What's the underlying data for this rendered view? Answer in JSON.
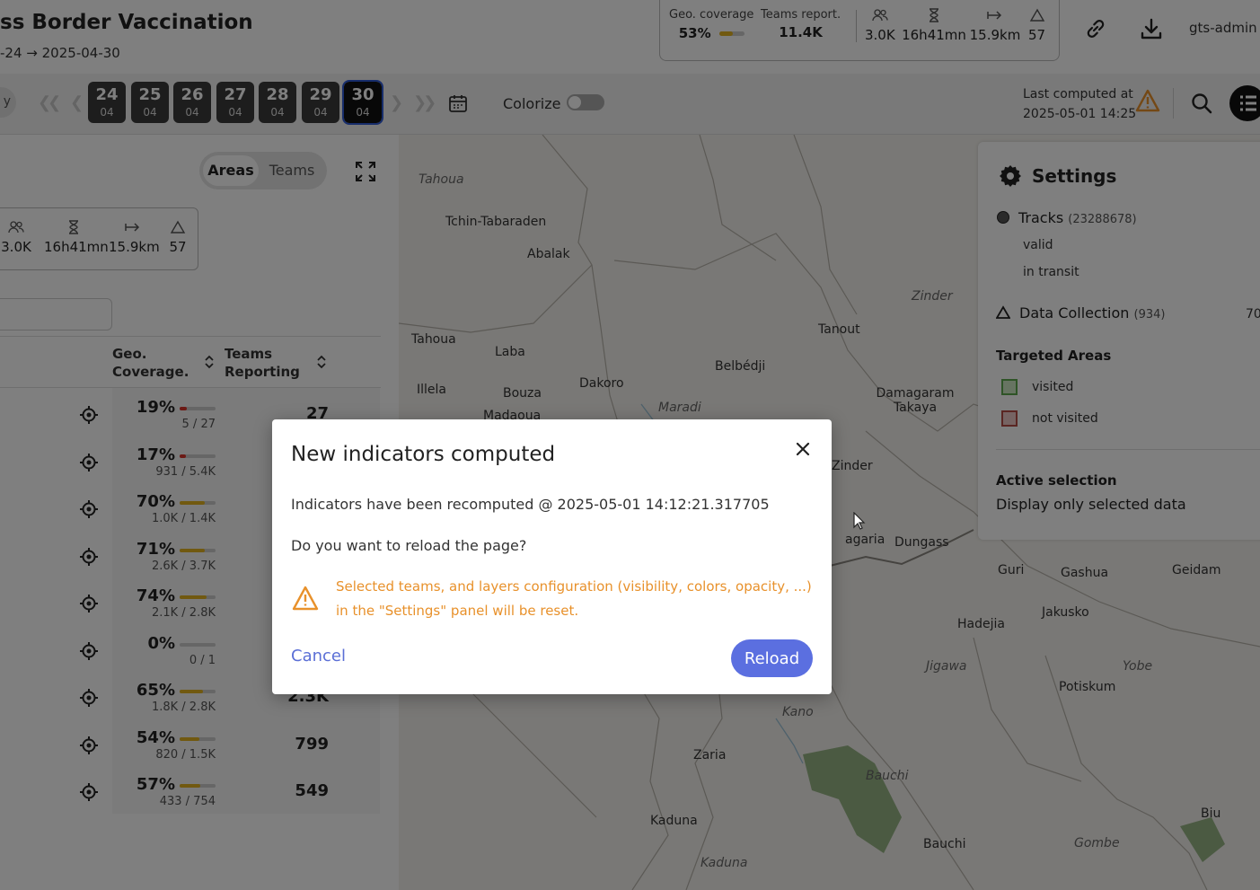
{
  "header": {
    "title": "ss Border Vaccination",
    "date_from": "-24",
    "date_arrow": "→",
    "date_to": "2025-04-30",
    "stats": {
      "geo_coverage_label": "Geo. coverage",
      "geo_coverage_value": "53%",
      "geo_coverage_fraction": 0.53,
      "teams_report_label": "Teams report.",
      "teams_report_value": "11.4K",
      "people_value": "3.0K",
      "duration_value": "16h41mn",
      "distance_value": "15.9km",
      "alerts_value": "57"
    },
    "user": "gts-admin"
  },
  "toolbar": {
    "left_pill_text": "y",
    "days": [
      {
        "day": "24",
        "month": "04",
        "selected": false
      },
      {
        "day": "25",
        "month": "04",
        "selected": false
      },
      {
        "day": "26",
        "month": "04",
        "selected": false
      },
      {
        "day": "27",
        "month": "04",
        "selected": false
      },
      {
        "day": "28",
        "month": "04",
        "selected": false
      },
      {
        "day": "29",
        "month": "04",
        "selected": false
      },
      {
        "day": "30",
        "month": "04",
        "selected": true
      }
    ],
    "colorize_label": "Colorize",
    "colorize_on": false,
    "last_computed_label": "Last computed at",
    "last_computed_value": "2025-05-01 14:25"
  },
  "left_panel": {
    "view_toggle": {
      "areas": "Areas",
      "teams": "Teams",
      "selected": "Areas"
    },
    "mini_stats": {
      "people": "3.0K",
      "duration": "16h41mn",
      "distance": "15.9km",
      "alerts": "57"
    },
    "columns": {
      "geo_coverage": "Geo.\nCoverage.",
      "teams_reporting": "Teams\nReporting"
    },
    "rows": [
      {
        "pct": "19%",
        "fraction": 0.19,
        "bar_color": "#d9342b",
        "frac": "5 / 27",
        "teams": "27"
      },
      {
        "pct": "17%",
        "fraction": 0.17,
        "bar_color": "#d9342b",
        "frac": "931 / 5.4K",
        "teams": ""
      },
      {
        "pct": "70%",
        "fraction": 0.7,
        "bar_color": "#e2b320",
        "frac": "1.0K / 1.4K",
        "teams": ""
      },
      {
        "pct": "71%",
        "fraction": 0.71,
        "bar_color": "#e2b320",
        "frac": "2.6K / 3.7K",
        "teams": ""
      },
      {
        "pct": "74%",
        "fraction": 0.74,
        "bar_color": "#e2b320",
        "frac": "2.1K / 2.8K",
        "teams": ""
      },
      {
        "pct": "0%",
        "fraction": 0.0,
        "bar_color": "#d9342b",
        "frac": "0 / 1",
        "teams": ""
      },
      {
        "pct": "65%",
        "fraction": 0.65,
        "bar_color": "#e2b320",
        "frac": "1.8K / 2.8K",
        "teams": "2.3K"
      },
      {
        "pct": "54%",
        "fraction": 0.54,
        "bar_color": "#e2b320",
        "frac": "820 / 1.5K",
        "teams": "799"
      },
      {
        "pct": "57%",
        "fraction": 0.57,
        "bar_color": "#e2b320",
        "frac": "433 / 754",
        "teams": "549"
      }
    ]
  },
  "map": {
    "places": [
      {
        "name": "Tahoua",
        "italic": true
      },
      {
        "name": "Tchin-Tabaraden",
        "italic": false
      },
      {
        "name": "Abalak",
        "italic": false
      },
      {
        "name": "Zinder",
        "italic": true
      },
      {
        "name": "Tahoua",
        "italic": false
      },
      {
        "name": "Laba",
        "italic": false
      },
      {
        "name": "Tanout",
        "italic": false
      },
      {
        "name": "Belbédji",
        "italic": false
      },
      {
        "name": "Illela",
        "italic": false
      },
      {
        "name": "Bouza",
        "italic": false
      },
      {
        "name": "Dakoro",
        "italic": false
      },
      {
        "name": "Damagaram Takaya",
        "italic": false
      },
      {
        "name": "Madaoua",
        "italic": false
      },
      {
        "name": "Maradi",
        "italic": true
      },
      {
        "name": "Zinder",
        "italic": false
      },
      {
        "name": "agaria",
        "italic": false
      },
      {
        "name": "Dungass",
        "italic": false
      },
      {
        "name": "Guri",
        "italic": false
      },
      {
        "name": "Gashua",
        "italic": false
      },
      {
        "name": "Geidam",
        "italic": false
      },
      {
        "name": "Jakusko",
        "italic": false
      },
      {
        "name": "Hadejia",
        "italic": false
      },
      {
        "name": "Jigawa",
        "italic": true
      },
      {
        "name": "Yobe",
        "italic": true
      },
      {
        "name": "Potiskum",
        "italic": false
      },
      {
        "name": "Kano",
        "italic": true
      },
      {
        "name": "Zaria",
        "italic": false
      },
      {
        "name": "Bauchi",
        "italic": true
      },
      {
        "name": "Kaduna",
        "italic": false
      },
      {
        "name": "Bauchi",
        "italic": false
      },
      {
        "name": "Gombe",
        "italic": true
      },
      {
        "name": "Biu",
        "italic": false
      },
      {
        "name": "Kaduna",
        "italic": true
      }
    ]
  },
  "settings": {
    "title": "Settings",
    "tracks_label": "Tracks",
    "tracks_count": "(23288678)",
    "valid_label": "valid",
    "in_transit_label": "in transit",
    "data_collection_label": "Data Collection",
    "data_collection_count": "(934)",
    "data_collection_right": "70",
    "targeted_areas_label": "Targeted Areas",
    "visited_label": "visited",
    "not_visited_label": "not visited",
    "active_selection_label": "Active selection",
    "display_selected_label": "Display only selected data"
  },
  "modal": {
    "title": "New indicators computed",
    "message": "Indicators have been recomputed @ 2025-05-01 14:12:21.317705",
    "question": "Do you want to reload the page?",
    "warning": "Selected teams, and layers configuration (visibility, colors, opacity, ...) in the \"Settings\" panel will be reset.",
    "cancel_label": "Cancel",
    "reload_label": "Reload"
  },
  "colors": {
    "accent": "#5b6fe0",
    "warning": "#e8912b",
    "coverage_good": "#e2b320",
    "coverage_bad": "#d9342b",
    "visited": "#7fc36a",
    "not_visited": "#c96a63"
  }
}
